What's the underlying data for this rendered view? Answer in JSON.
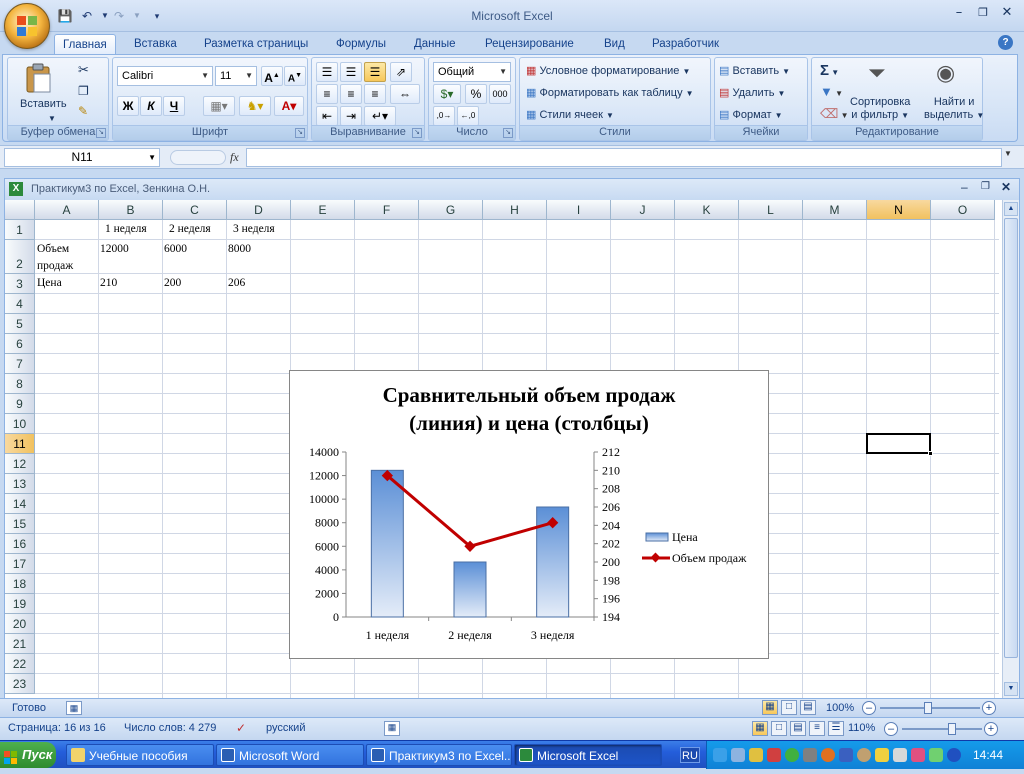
{
  "app": {
    "title": "Microsoft Excel"
  },
  "tabs": [
    "Главная",
    "Вставка",
    "Разметка страницы",
    "Формулы",
    "Данные",
    "Рецензирование",
    "Вид",
    "Разработчик"
  ],
  "ribbon": {
    "clipboard": {
      "label": "Буфер обмена",
      "paste": "Вставить"
    },
    "font": {
      "label": "Шрифт",
      "name": "Calibri",
      "size": "11",
      "bold": "Ж",
      "italic": "К",
      "underline": "Ч"
    },
    "alignment": {
      "label": "Выравнивание"
    },
    "number": {
      "label": "Число",
      "format": "Общий"
    },
    "styles": {
      "label": "Стили",
      "conditional": "Условное форматирование",
      "as_table": "Форматировать как таблицу",
      "cell_styles": "Стили ячеек"
    },
    "cells": {
      "label": "Ячейки",
      "insert": "Вставить",
      "delete": "Удалить",
      "format": "Формат"
    },
    "editing": {
      "label": "Редактирование",
      "sort_1": "Сортировка",
      "sort_2": "и фильтр",
      "find_1": "Найти и",
      "find_2": "выделить"
    }
  },
  "formula_bar": {
    "name_box": "N11",
    "fx": "fx",
    "value": ""
  },
  "workbook": {
    "title": "Практикум3 по Excel, Зенкина О.Н."
  },
  "columns": [
    "A",
    "B",
    "C",
    "D",
    "E",
    "F",
    "G",
    "H",
    "I",
    "J",
    "K",
    "L",
    "M",
    "N",
    "O"
  ],
  "selected": {
    "column": "N",
    "row": 11
  },
  "rows": [
    1,
    2,
    3,
    4,
    5,
    6,
    7,
    8,
    9,
    10,
    11,
    12,
    13,
    14,
    15,
    16,
    17,
    18,
    19,
    20,
    21,
    22,
    23
  ],
  "cells": {
    "B1": "1 неделя",
    "C1": "2 неделя",
    "D1": "3 неделя",
    "A2a": "Объем",
    "A2b": "продаж",
    "B2": "12000",
    "C2": "6000",
    "D2": "8000",
    "A3": "Цена",
    "B3": "210",
    "C3": "200",
    "D3": "206"
  },
  "chart_data": {
    "type": "bar",
    "title_line1": "Сравнительный объем продаж",
    "title_line2": "(линия) и цена (столбцы)",
    "categories": [
      "1 неделя",
      "2 неделя",
      "3 неделя"
    ],
    "series": [
      {
        "name": "Цена",
        "type": "bar",
        "axis": "left",
        "values": [
          210,
          200,
          206
        ],
        "color": "#7fa7dc"
      },
      {
        "name": "Объем продаж",
        "type": "line",
        "axis": "right",
        "values": [
          12000,
          6000,
          8000
        ],
        "color": "#c00000"
      }
    ],
    "left_axis": {
      "min": 0,
      "max": 14000,
      "ticks": [
        "0",
        "2000",
        "4000",
        "6000",
        "8000",
        "10000",
        "12000",
        "14000"
      ]
    },
    "right_axis": {
      "min": 194,
      "max": 212,
      "ticks": [
        "194",
        "196",
        "198",
        "200",
        "202",
        "204",
        "206",
        "208",
        "210",
        "212"
      ]
    },
    "legend_position": "right"
  },
  "status": {
    "ready": "Готово",
    "zoom": "100%"
  },
  "word_status": {
    "page": "Страница: 16 из 16",
    "words": "Число слов: 4 279",
    "lang": "русский",
    "zoom": "110%"
  },
  "taskbar": {
    "start": "Пуск",
    "tasks": [
      "Учебные пособия",
      "Microsoft Word",
      "Практикум3 по Excel...",
      "Microsoft Excel"
    ],
    "lang": "RU",
    "clock": "14:44"
  }
}
